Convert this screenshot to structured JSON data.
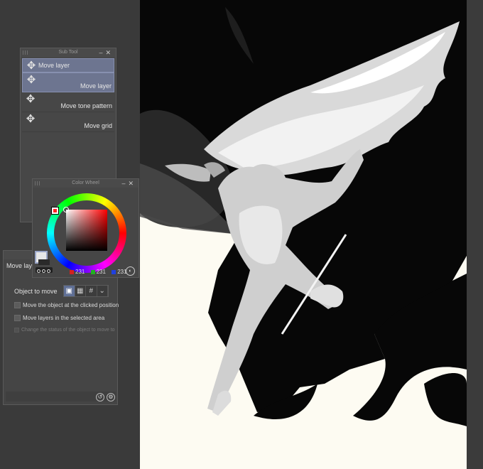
{
  "subtool": {
    "title": "Sub Tool",
    "items": [
      {
        "label": "Move layer",
        "icon": "move-arrows-icon"
      },
      {
        "label": "Move layer",
        "icon": "move-arrows-icon"
      },
      {
        "label": "Move tone pattern",
        "icon": "move-arrows-icon"
      },
      {
        "label": "Move grid",
        "icon": "move-arrows-icon"
      }
    ]
  },
  "colorwheel": {
    "title": "Color Wheel",
    "r": "231",
    "g": "231",
    "b": "231",
    "main_color": "#e7e7e7"
  },
  "toolprop": {
    "heading": "Move lay",
    "object_to_move_label": "Object to move",
    "object_options": [
      "layer-icon",
      "tone-pattern-icon",
      "grid-icon"
    ],
    "checkboxes": [
      "Move the object at the clicked position",
      "Move layers in the selected area",
      "Change the status of the object to move to"
    ]
  },
  "colors": {
    "panel_bg": "#474747",
    "selection": "#6d7590",
    "canvas_paper": "#fdfbf2"
  }
}
